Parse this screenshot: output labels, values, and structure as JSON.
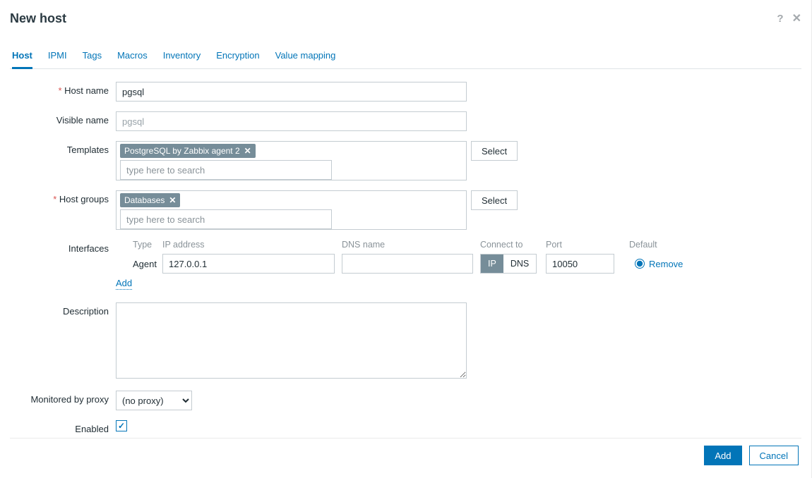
{
  "dialog": {
    "title": "New host"
  },
  "tabs": [
    "Host",
    "IPMI",
    "Tags",
    "Macros",
    "Inventory",
    "Encryption",
    "Value mapping"
  ],
  "active_tab_index": 0,
  "labels": {
    "host_name": "Host name",
    "visible_name": "Visible name",
    "templates": "Templates",
    "host_groups": "Host groups",
    "interfaces": "Interfaces",
    "description": "Description",
    "proxy": "Monitored by proxy",
    "enabled": "Enabled"
  },
  "fields": {
    "host_name": "pgsql",
    "visible_name_placeholder": "pgsql",
    "templates": [
      "PostgreSQL by Zabbix agent 2"
    ],
    "templates_placeholder": "type here to search",
    "host_groups": [
      "Databases"
    ],
    "host_groups_placeholder": "type here to search",
    "description": "",
    "proxy": "(no proxy)",
    "enabled": true
  },
  "interfaces": {
    "headers": {
      "type": "Type",
      "ip": "IP address",
      "dns": "DNS name",
      "connect": "Connect to",
      "port": "Port",
      "default": "Default"
    },
    "rows": [
      {
        "type": "Agent",
        "ip": "127.0.0.1",
        "dns": "",
        "connect_ip": "IP",
        "connect_dns": "DNS",
        "connect_selected": "IP",
        "port": "10050",
        "default": true,
        "remove": "Remove"
      }
    ],
    "add": "Add"
  },
  "buttons": {
    "select": "Select",
    "add": "Add",
    "cancel": "Cancel"
  }
}
